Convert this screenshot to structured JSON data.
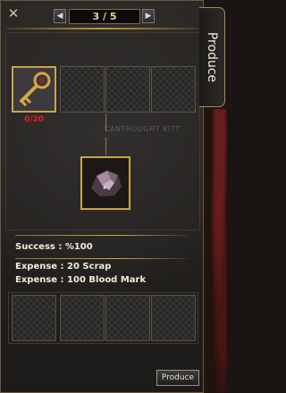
{
  "window": {
    "close_glyph": "✕",
    "side_tab_label": "Produce"
  },
  "pager": {
    "prev_glyph": "◀",
    "next_glyph": "▶",
    "current": "3 / 5"
  },
  "materials": {
    "required_count": "0/20",
    "slots": [
      {
        "icon": "golden-key-icon",
        "filled": true
      },
      {
        "icon": "empty-slot",
        "filled": false
      },
      {
        "icon": "empty-slot",
        "filled": false
      },
      {
        "icon": "empty-slot",
        "filled": false
      }
    ]
  },
  "result": {
    "icon": "raw-ore-icon",
    "watermark_text": "CANTHOUGHT KITT"
  },
  "info": {
    "success": "Success : %100",
    "expense_1": "Expense : 20 Scrap",
    "expense_2": "Expense : 100 Blood Mark"
  },
  "actions": {
    "produce_label": "Produce"
  },
  "colors": {
    "gold_accent": "#c9a44a",
    "count_red": "#e02020",
    "text_cream": "#f2ecd6"
  }
}
